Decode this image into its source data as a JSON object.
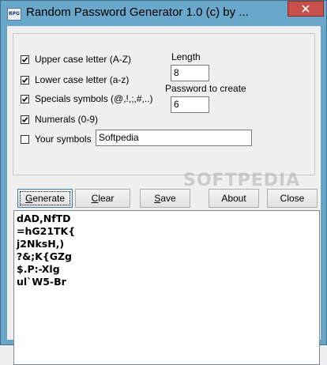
{
  "window": {
    "title": "Random Password Generator 1.0 (c) by ...",
    "icon_text": "RPG"
  },
  "options": {
    "upper": {
      "label": "Upper case letter (A-Z)",
      "checked": true
    },
    "lower": {
      "label": "Lower case letter (a-z)",
      "checked": true
    },
    "specials": {
      "label": "Specials symbols (@,!,;,#,..)",
      "checked": true
    },
    "numerals": {
      "label": "Numerals (0-9)",
      "checked": true
    },
    "your_symbols": {
      "label": "Your symbols",
      "checked": false,
      "value": "Softpedia"
    }
  },
  "length": {
    "label": "Length",
    "value": "8"
  },
  "password_count": {
    "label": "Password to create",
    "value": "6"
  },
  "watermark": "SOFTPEDIA",
  "buttons": {
    "generate": {
      "pre": "",
      "accel": "G",
      "post": "enerate"
    },
    "clear": {
      "pre": "",
      "accel": "C",
      "post": "lear"
    },
    "save": {
      "pre": "",
      "accel": "S",
      "post": "ave"
    },
    "about": {
      "label": "About"
    },
    "close": {
      "label": "Close"
    }
  },
  "passwords": [
    "dAD,NfTD",
    "=hG21TK{",
    "j2NksH,)",
    "?&;K{GZg",
    "$.P:-Xlg",
    "ul`W5-Br"
  ],
  "colors": {
    "titlebar": "#6aa8cb",
    "close_button": "#c7504a",
    "background": "#f0f0f0"
  }
}
